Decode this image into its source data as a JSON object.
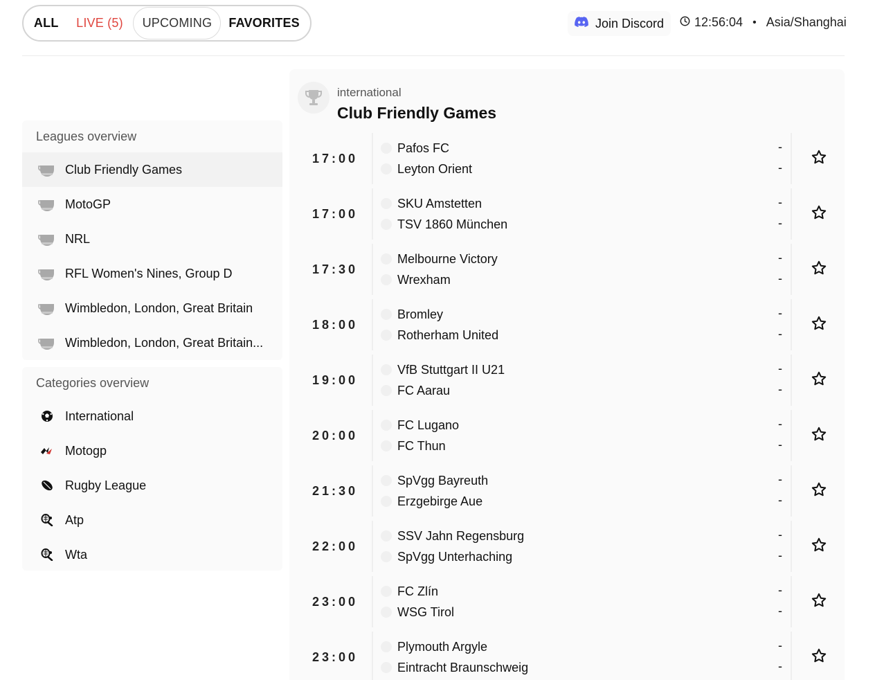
{
  "tabs": {
    "all": "ALL",
    "live": "LIVE (5)",
    "upcoming": "UPCOMING",
    "favorites": "FAVORITES"
  },
  "header": {
    "discord_label": "Join Discord",
    "time": "12:56:04",
    "separator": "•",
    "timezone": "Asia/Shanghai"
  },
  "leagues_overview": {
    "title": "Leagues overview",
    "items": [
      {
        "label": "Club Friendly Games",
        "icon": "trophy-icon"
      },
      {
        "label": "MotoGP",
        "icon": "trophy-icon"
      },
      {
        "label": "NRL",
        "icon": "trophy-icon"
      },
      {
        "label": "RFL Women's Nines, Group D",
        "icon": "trophy-icon"
      },
      {
        "label": "Wimbledon, London, Great Britain",
        "icon": "trophy-icon"
      },
      {
        "label": "Wimbledon, London, Great Britain...",
        "icon": "trophy-icon"
      }
    ]
  },
  "categories_overview": {
    "title": "Categories overview",
    "items": [
      {
        "label": "International",
        "icon": "soccer-ball-icon"
      },
      {
        "label": "Motogp",
        "icon": "motogp-logo-icon"
      },
      {
        "label": "Rugby League",
        "icon": "rugby-ball-icon"
      },
      {
        "label": "Atp",
        "icon": "tennis-icon"
      },
      {
        "label": "Wta",
        "icon": "tennis-icon"
      }
    ]
  },
  "league": {
    "category": "international",
    "name": "Club Friendly Games"
  },
  "matches": [
    {
      "time": "17:00",
      "home": "Pafos FC",
      "away": "Leyton Orient",
      "home_score": "-",
      "away_score": "-"
    },
    {
      "time": "17:00",
      "home": "SKU Amstetten",
      "away": "TSV 1860 München",
      "home_score": "-",
      "away_score": "-"
    },
    {
      "time": "17:30",
      "home": "Melbourne Victory",
      "away": "Wrexham",
      "home_score": "-",
      "away_score": "-"
    },
    {
      "time": "18:00",
      "home": "Bromley",
      "away": "Rotherham United",
      "home_score": "-",
      "away_score": "-"
    },
    {
      "time": "19:00",
      "home": "VfB Stuttgart II U21",
      "away": "FC Aarau",
      "home_score": "-",
      "away_score": "-"
    },
    {
      "time": "20:00",
      "home": "FC Lugano",
      "away": "FC Thun",
      "home_score": "-",
      "away_score": "-"
    },
    {
      "time": "21:30",
      "home": "SpVgg Bayreuth",
      "away": "Erzgebirge Aue",
      "home_score": "-",
      "away_score": "-"
    },
    {
      "time": "22:00",
      "home": "SSV Jahn Regensburg",
      "away": "SpVgg Unterhaching",
      "home_score": "-",
      "away_score": "-"
    },
    {
      "time": "23:00",
      "home": "FC Zlín",
      "away": "WSG Tirol",
      "home_score": "-",
      "away_score": "-"
    },
    {
      "time": "23:00",
      "home": "Plymouth Argyle",
      "away": "Eintracht Braunschweig",
      "home_score": "-",
      "away_score": "-"
    }
  ],
  "colors": {
    "live": "#e0463f",
    "discord": "#5865F2"
  }
}
